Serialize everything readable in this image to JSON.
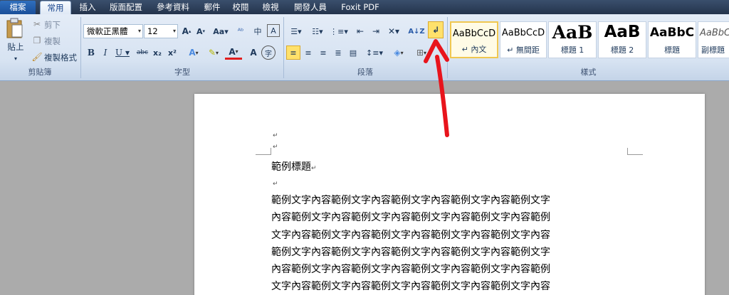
{
  "tabs": [
    "檔案",
    "常用",
    "插入",
    "版面配置",
    "參考資料",
    "郵件",
    "校閱",
    "檢視",
    "開發人員",
    "Foxit PDF"
  ],
  "clipboard": {
    "paste": "貼上",
    "cut": "剪下",
    "copy": "複製",
    "format_painter": "複製格式",
    "group": "剪貼簿"
  },
  "font": {
    "name": "微軟正黑體",
    "size": "12",
    "group": "字型"
  },
  "paragraph": {
    "group": "段落"
  },
  "styles": {
    "group": "樣式",
    "items": [
      {
        "preview": "AaBbCcD",
        "name": "↵ 內文"
      },
      {
        "preview": "AaBbCcD",
        "name": "↵ 無間距"
      },
      {
        "preview": "AaB",
        "name": "標題 1"
      },
      {
        "preview": "AaB",
        "name": "標題 2"
      },
      {
        "preview": "AaBbC",
        "name": "標題"
      },
      {
        "preview": "AaBbCc",
        "name": "副標題"
      }
    ]
  },
  "document": {
    "para_mark": "↵",
    "title": "範例標題",
    "title_mark": "↵",
    "lines": [
      "範例文字內容範例文字內容範例文字內容範例文字內容範例文字",
      "內容範例文字內容範例文字內容範例文字內容範例文字內容範例",
      "文字內容範例文字內容範例文字內容範例文字內容範例文字內容",
      "範例文字內容範例文字內容範例文字內容範例文字內容範例文字",
      "內容範例文字內容範例文字內容範例文字內容範例文字內容範例",
      "文字內容範例文字內容範例文字內容範例文字內容範例文字內容"
    ]
  },
  "colors": {
    "annotation_arrow": "#e8141c",
    "highlight_button": "#ffe16b"
  }
}
